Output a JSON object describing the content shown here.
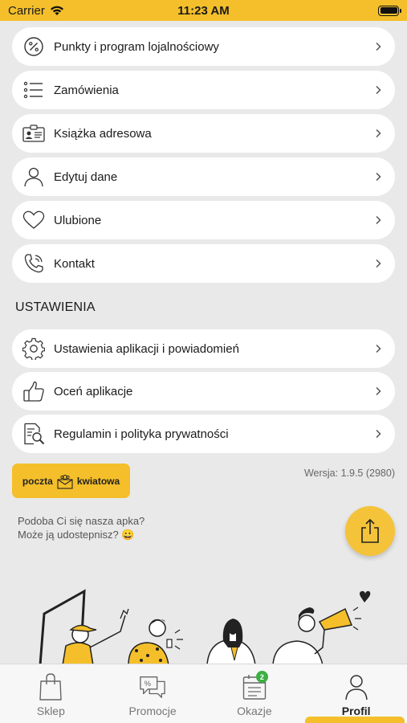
{
  "status_bar": {
    "carrier": "Carrier",
    "time": "11:23 AM"
  },
  "menu": [
    {
      "label": "Punkty i program lojalnościowy",
      "icon": "percent-icon"
    },
    {
      "label": "Zamówienia",
      "icon": "list-icon"
    },
    {
      "label": "Książka adresowa",
      "icon": "address-card-icon"
    },
    {
      "label": "Edytuj dane",
      "icon": "user-icon"
    },
    {
      "label": "Ulubione",
      "icon": "heart-icon"
    },
    {
      "label": "Kontakt",
      "icon": "phone-icon"
    }
  ],
  "settings_header": "USTAWIENIA",
  "settings": [
    {
      "label": "Ustawienia aplikacji i powiadomień",
      "icon": "gear-icon"
    },
    {
      "label": "Oceń aplikacje",
      "icon": "thumbs-up-icon"
    },
    {
      "label": "Regulamin i polityka prywatności",
      "icon": "document-search-icon"
    }
  ],
  "logo": {
    "left": "poczta",
    "right": "kwiatowa"
  },
  "version": "Wersja: 1.9.5 (2980)",
  "share": {
    "line1": "Podoba Ci się nasza apka?",
    "line2": "Może ją udostepnisz? 😀"
  },
  "tabs": [
    {
      "label": "Sklep",
      "icon": "shopping-bag-icon"
    },
    {
      "label": "Promocje",
      "icon": "promo-chat-icon"
    },
    {
      "label": "Okazje",
      "icon": "calendar-icon",
      "badge": "2"
    },
    {
      "label": "Profil",
      "icon": "profile-icon",
      "active": true
    }
  ],
  "colors": {
    "accent": "#f4bf2a",
    "badge": "#3cb043",
    "background": "#e9e9e9"
  }
}
